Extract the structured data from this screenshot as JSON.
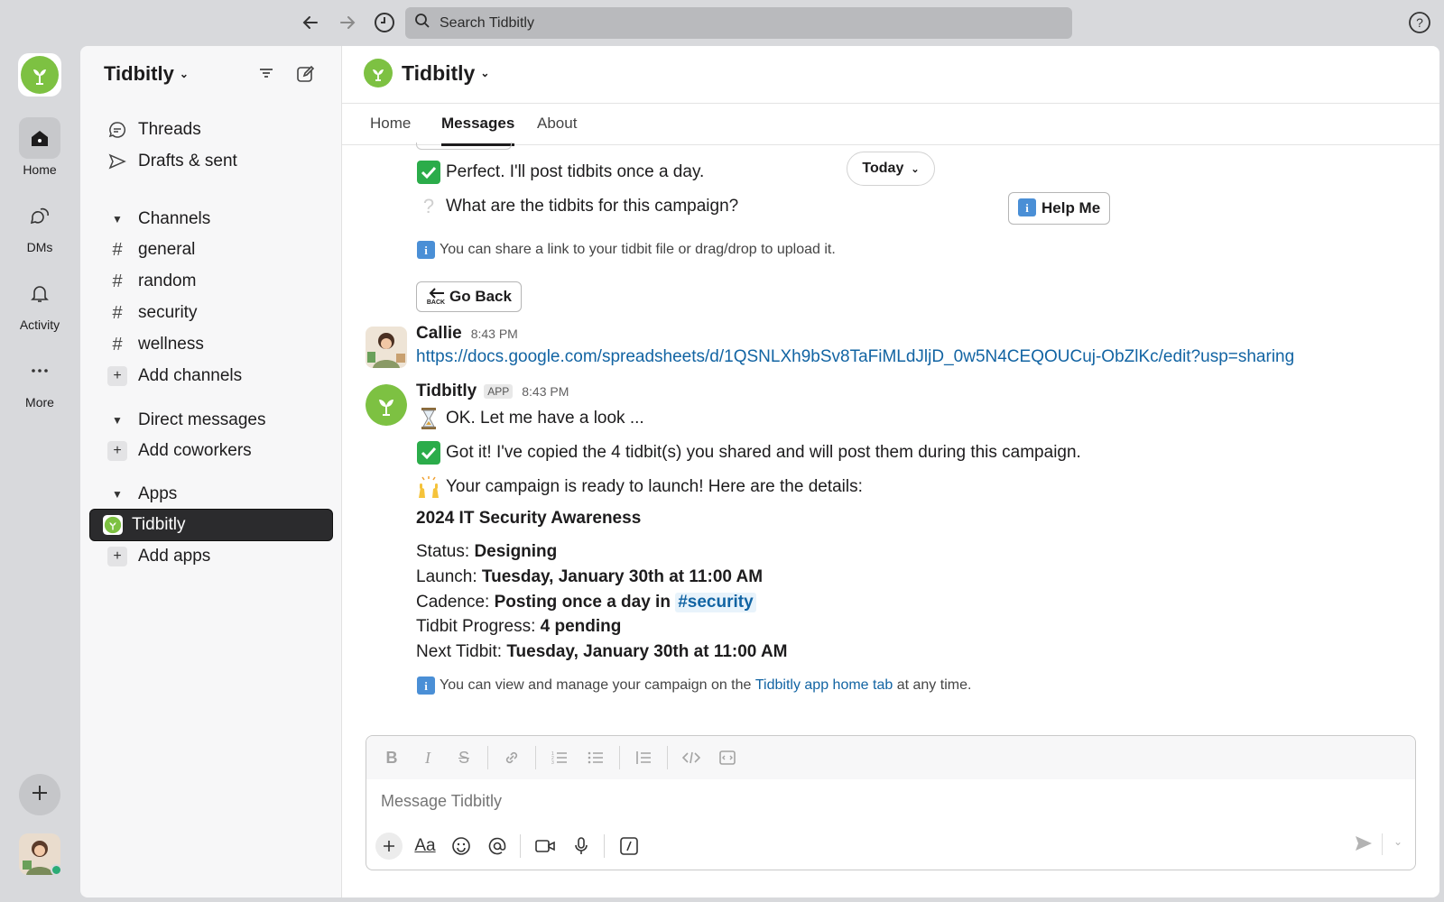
{
  "search": {
    "placeholder": "Search Tidbitly"
  },
  "rail": {
    "items": [
      {
        "label": "Home"
      },
      {
        "label": "DMs"
      },
      {
        "label": "Activity"
      },
      {
        "label": "More"
      }
    ]
  },
  "sidebar": {
    "workspace": "Tidbitly",
    "top_items": [
      {
        "label": "Threads"
      },
      {
        "label": "Drafts & sent"
      }
    ],
    "channels_header": "Channels",
    "channels": [
      "general",
      "random",
      "security",
      "wellness"
    ],
    "add_channels": "Add channels",
    "dm_header": "Direct messages",
    "add_coworkers": "Add coworkers",
    "apps_header": "Apps",
    "app_selected": "Tidbitly",
    "add_apps": "Add apps"
  },
  "channel": {
    "title": "Tidbitly",
    "tabs": [
      "Home",
      "Messages",
      "About"
    ],
    "active_tab": "Messages"
  },
  "feed": {
    "today_label": "Today",
    "msg_perfect": "Perfect. I'll post tidbits once a day.",
    "msg_question": "What are the tidbits for this campaign?",
    "help_button": "Help Me",
    "info_share": "You can share a link to your tidbit file or drag/drop to upload it.",
    "go_back_button": "Go Back",
    "callie": {
      "name": "Callie",
      "time": "8:43 PM",
      "link": "https://docs.google.com/spreadsheets/d/1QSNLXh9bSv8TaFiMLdJljD_0w5N4CEQOUCuj-ObZlKc/edit?usp=sharing"
    },
    "bot": {
      "name": "Tidbitly",
      "badge": "APP",
      "time": "8:43 PM",
      "lines": [
        "OK. Let me have a look ...",
        "Got it! I've copied the 4 tidbit(s) you shared and will post them during this campaign.",
        "Your campaign is ready to launch! Here are the details:"
      ],
      "campaign_title": "2024 IT Security Awareness",
      "details": {
        "status_label": "Status:",
        "status_value": "Designing",
        "launch_label": "Launch:",
        "launch_value": "Tuesday, January 30th at 11:00 AM",
        "cadence_label": "Cadence:",
        "cadence_value": "Posting once a day in",
        "cadence_channel": "#security",
        "progress_label": "Tidbit Progress:",
        "progress_value": "4 pending",
        "next_label": "Next Tidbit:",
        "next_value": "Tuesday, January 30th at 11:00 AM"
      },
      "footer_pre": "You can view and manage your campaign on the",
      "footer_link": "Tidbitly app home tab",
      "footer_post": "at any time."
    }
  },
  "composer": {
    "placeholder": "Message Tidbitly"
  },
  "colors": {
    "brand_green": "#7dc142",
    "link_blue": "#1264a3",
    "selected_bg": "#2b2b2d"
  }
}
